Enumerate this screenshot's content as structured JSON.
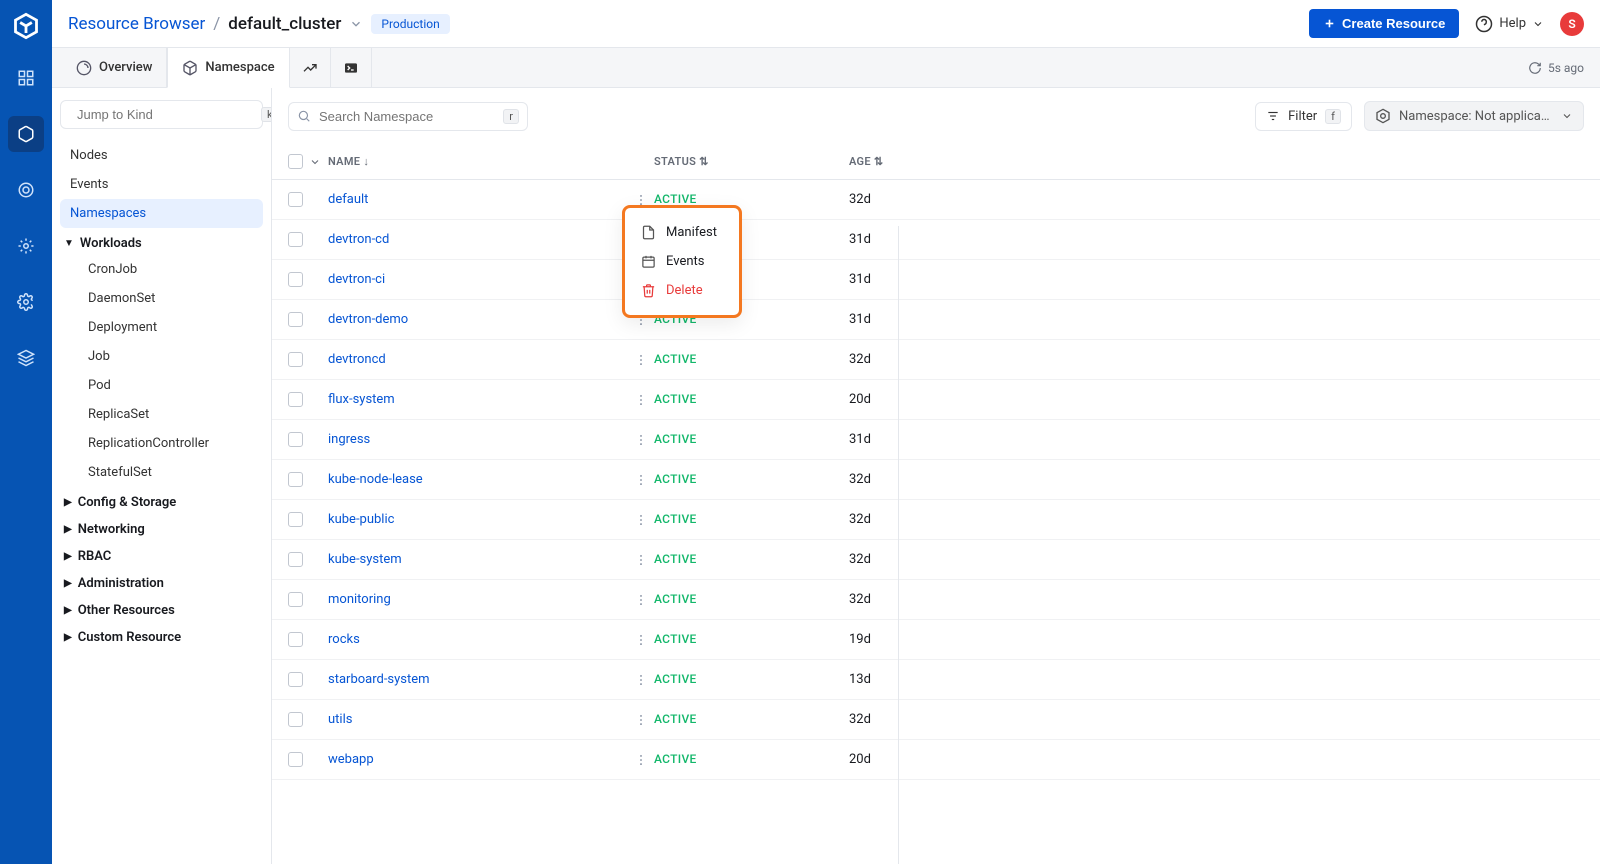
{
  "breadcrumb": {
    "root": "Resource Browser",
    "cluster": "default_cluster",
    "env_badge": "Production"
  },
  "top": {
    "create_btn": "Create Resource",
    "help": "Help",
    "avatar_initial": "S",
    "refresh": "5s ago"
  },
  "tabs": {
    "overview": "Overview",
    "namespace": "Namespace"
  },
  "sidebar": {
    "jump_placeholder": "Jump to Kind",
    "jump_key": "k",
    "nodes": "Nodes",
    "events": "Events",
    "namespaces": "Namespaces",
    "groups": {
      "workloads": "Workloads",
      "config_storage": "Config & Storage",
      "networking": "Networking",
      "rbac": "RBAC",
      "administration": "Administration",
      "other": "Other Resources",
      "custom": "Custom Resource"
    },
    "workloads_items": [
      "CronJob",
      "DaemonSet",
      "Deployment",
      "Job",
      "Pod",
      "ReplicaSet",
      "ReplicationController",
      "StatefulSet"
    ]
  },
  "toolbar": {
    "search_placeholder": "Search Namespace",
    "search_key": "r",
    "filter_label": "Filter",
    "filter_key": "f",
    "ns_label": "Namespace: Not applicable"
  },
  "columns": {
    "name": "NAME",
    "status": "STATUS",
    "age": "AGE"
  },
  "rows": [
    {
      "name": "default",
      "status": "ACTIVE",
      "age": "32d",
      "show_status": true
    },
    {
      "name": "devtron-cd",
      "status": "",
      "age": "31d",
      "show_status": false
    },
    {
      "name": "devtron-ci",
      "status": "",
      "age": "31d",
      "show_status": false
    },
    {
      "name": "devtron-demo",
      "status": "ACTIVE",
      "age": "31d",
      "show_status": true
    },
    {
      "name": "devtroncd",
      "status": "ACTIVE",
      "age": "32d",
      "show_status": true
    },
    {
      "name": "flux-system",
      "status": "ACTIVE",
      "age": "20d",
      "show_status": true
    },
    {
      "name": "ingress",
      "status": "ACTIVE",
      "age": "31d",
      "show_status": true
    },
    {
      "name": "kube-node-lease",
      "status": "ACTIVE",
      "age": "32d",
      "show_status": true
    },
    {
      "name": "kube-public",
      "status": "ACTIVE",
      "age": "32d",
      "show_status": true
    },
    {
      "name": "kube-system",
      "status": "ACTIVE",
      "age": "32d",
      "show_status": true
    },
    {
      "name": "monitoring",
      "status": "ACTIVE",
      "age": "32d",
      "show_status": true
    },
    {
      "name": "rocks",
      "status": "ACTIVE",
      "age": "19d",
      "show_status": true
    },
    {
      "name": "starboard-system",
      "status": "ACTIVE",
      "age": "13d",
      "show_status": true
    },
    {
      "name": "utils",
      "status": "ACTIVE",
      "age": "32d",
      "show_status": true
    },
    {
      "name": "webapp",
      "status": "ACTIVE",
      "age": "20d",
      "show_status": true
    }
  ],
  "context_menu": {
    "manifest": "Manifest",
    "events": "Events",
    "delete": "Delete"
  }
}
